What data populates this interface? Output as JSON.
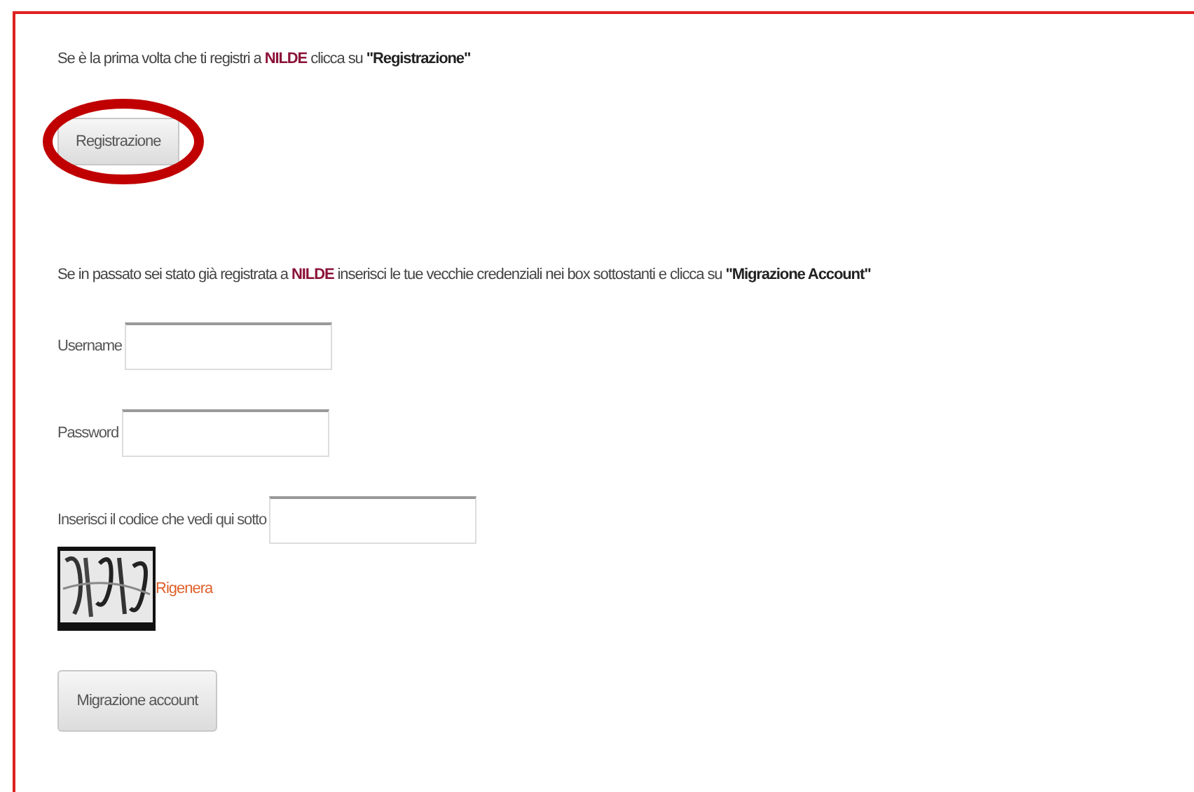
{
  "intro_text": [
    {
      "kind": "plain",
      "text": "Se è la prima volta che ti registri a "
    },
    {
      "kind": "brand",
      "text": "NILDE"
    },
    {
      "kind": "plain",
      "text": " clicca su "
    },
    {
      "kind": "bold",
      "text": "\"Registrazione\""
    }
  ],
  "register_button": {
    "label": "Registrazione",
    "highlighted": true
  },
  "migration_text": [
    {
      "kind": "plain",
      "text": "Se in passato sei stato già registrata a "
    },
    {
      "kind": "brand",
      "text": "NILDE"
    },
    {
      "kind": "plain",
      "text": " inserisci le tue vecchie credenziali nei box sottostanti e clicca su "
    },
    {
      "kind": "bold",
      "text": "\"Migrazione Account\""
    }
  ],
  "fields": [
    {
      "label": "Username"
    },
    {
      "label": "Password"
    },
    {
      "label": "Inserisci il codice che vedi qui sotto"
    }
  ],
  "captcha": {
    "kind": "picture",
    "refresh_link": "Rigenera"
  },
  "submit_button": {
    "label": "Migrazione account"
  }
}
